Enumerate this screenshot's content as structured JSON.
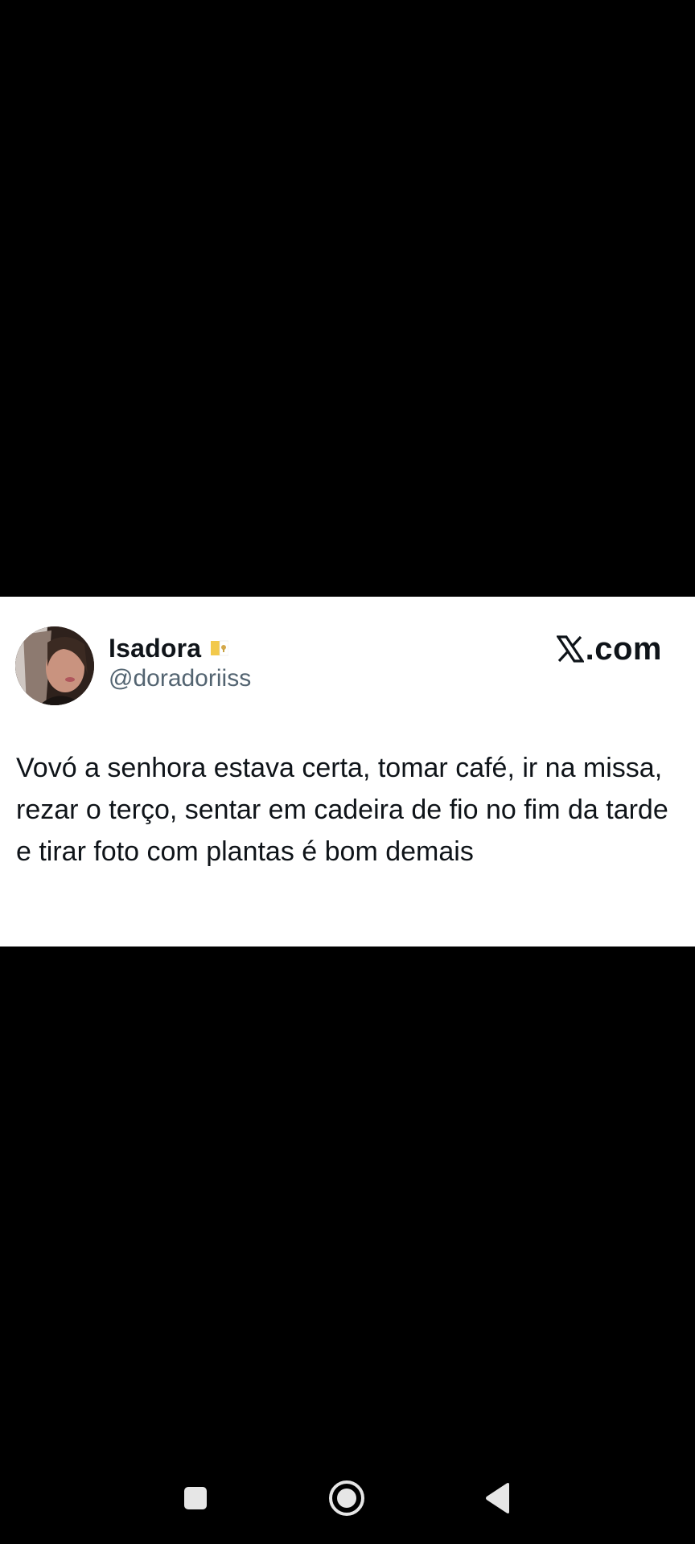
{
  "tweet": {
    "display_name": "Isadora",
    "username": "@doradoriiss",
    "text": "Vovó a senhora estava certa, tomar café, ir na missa, rezar o terço, sentar em cadeira de fio no fim da tarde e tirar foto com plantas é bom demais",
    "badge_icon": "vatican-flag-icon"
  },
  "brand": {
    "logo_icon": "x-logo-icon",
    "logo_text": ".com"
  },
  "nav": {
    "recents_icon": "square-icon",
    "home_icon": "circle-home-icon",
    "back_icon": "triangle-back-icon"
  },
  "colors": {
    "background": "#000000",
    "card": "#ffffff",
    "text_primary": "#0f1419",
    "text_secondary": "#536471",
    "nav_icon": "#e6e6e6"
  }
}
